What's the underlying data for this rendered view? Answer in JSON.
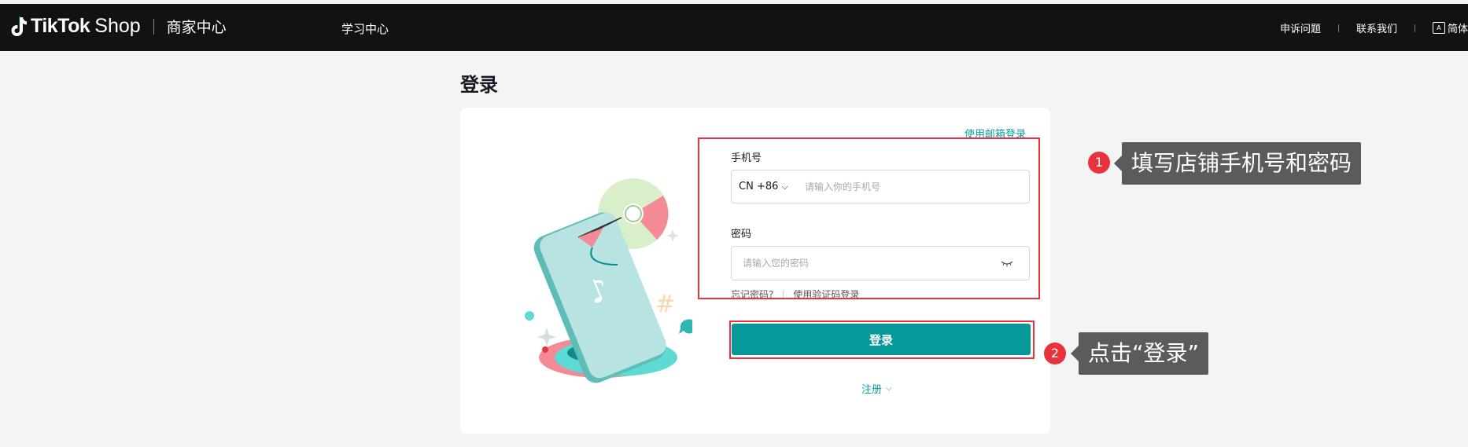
{
  "header": {
    "brand_tiktok": "TikTok",
    "brand_shop": "Shop",
    "brand_center": "商家中心",
    "nav_learn": "学习中心",
    "appeal": "申诉问题",
    "contact": "联系我们",
    "language": "简体",
    "lang_icon_text": "A"
  },
  "page": {
    "title": "登录"
  },
  "form": {
    "email_login_link": "使用邮箱登录",
    "phone_label": "手机号",
    "country_code": "CN +86",
    "phone_placeholder": "请输入你的手机号",
    "password_label": "密码",
    "password_placeholder": "请输入您的密码",
    "forgot_password": "忘记密码?",
    "code_login": "使用验证码登录",
    "login_button": "登录",
    "register": "注册"
  },
  "annotations": [
    {
      "number": "1",
      "text": "填写店铺手机号和密码"
    },
    {
      "number": "2",
      "text": "点击“登录”"
    }
  ],
  "colors": {
    "accent": "#07999a",
    "header_bg": "#121212",
    "annotation_red": "#e8323c",
    "tooltip_bg": "#5b5b5b"
  }
}
